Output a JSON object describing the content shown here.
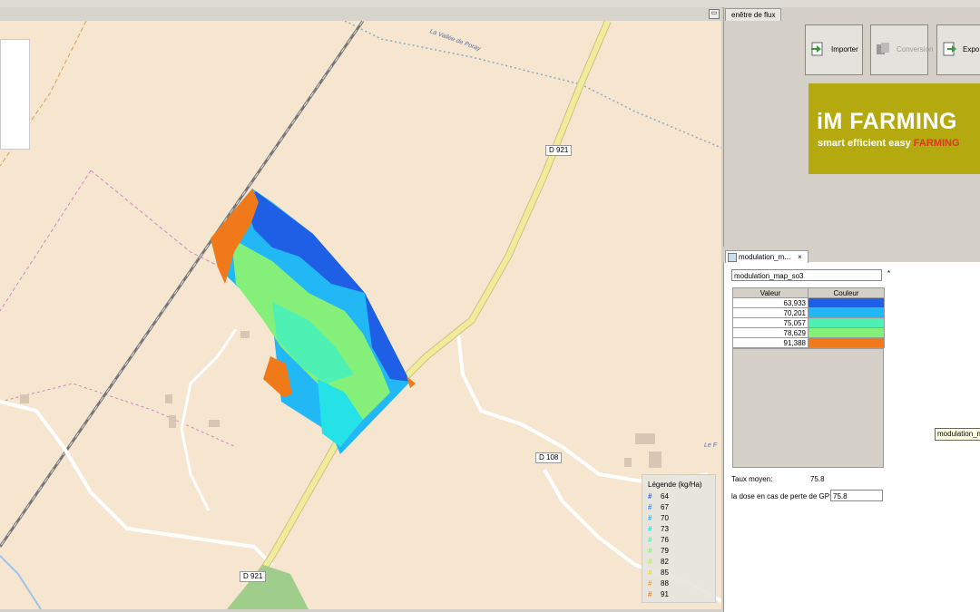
{
  "map": {
    "road_labels": [
      "D 921",
      "D 108",
      "D 921"
    ],
    "place_label": "La Vallée de Poray",
    "place_label_2": "Le F",
    "legend": {
      "title": "Légende  (kg/Ha)",
      "entries": [
        {
          "value": "64",
          "color": "#1e5fe6"
        },
        {
          "value": "67",
          "color": "#2f8bf2"
        },
        {
          "value": "70",
          "color": "#22b8f5"
        },
        {
          "value": "73",
          "color": "#25e2e6"
        },
        {
          "value": "76",
          "color": "#4ff0b4"
        },
        {
          "value": "79",
          "color": "#84f07a"
        },
        {
          "value": "82",
          "color": "#c8ee4c"
        },
        {
          "value": "85",
          "color": "#f0d43a"
        },
        {
          "value": "88",
          "color": "#f0a030"
        },
        {
          "value": "91",
          "color": "#f07a1a"
        }
      ]
    },
    "colors": {
      "background": "#f7e6cf",
      "road": "#f0ec9a",
      "blue_dark": "#1e5fe6",
      "blue": "#22b8f5",
      "cyan": "#25e2e6",
      "green": "#84f07a",
      "orange": "#f07a1a"
    }
  },
  "flux_panel": {
    "tab": "enêtre de flux",
    "buttons": [
      {
        "label": "Importer",
        "icon": "import-icon",
        "enabled": true
      },
      {
        "label": "Conversion",
        "icon": "convert-icon",
        "enabled": false
      },
      {
        "label": "Expo",
        "icon": "export-icon",
        "enabled": true
      }
    ],
    "logo": {
      "title": "iM FARMING",
      "tagline": "smart  efficient  easy",
      "tagline_accent": "FARMING"
    }
  },
  "modulation": {
    "tab": "modulation_m...",
    "name": "modulation_map_so3",
    "asterisk": "*",
    "table": {
      "headers": [
        "Valeur",
        "Couleur"
      ],
      "rows": [
        {
          "value": "63,933",
          "color": "#1e5fe6"
        },
        {
          "value": "70,201",
          "color": "#22b8f5"
        },
        {
          "value": "75,057",
          "color": "#4ff0b4"
        },
        {
          "value": "78,629",
          "color": "#84f07a"
        },
        {
          "value": "91,388",
          "color": "#f07a1a"
        }
      ]
    },
    "tooltip": "modulation_ma",
    "taux_label": "Taux moyen:",
    "taux_value": "75.8",
    "dose_label": "la dose en cas de perte de GPS:",
    "dose_value": "75.8"
  }
}
